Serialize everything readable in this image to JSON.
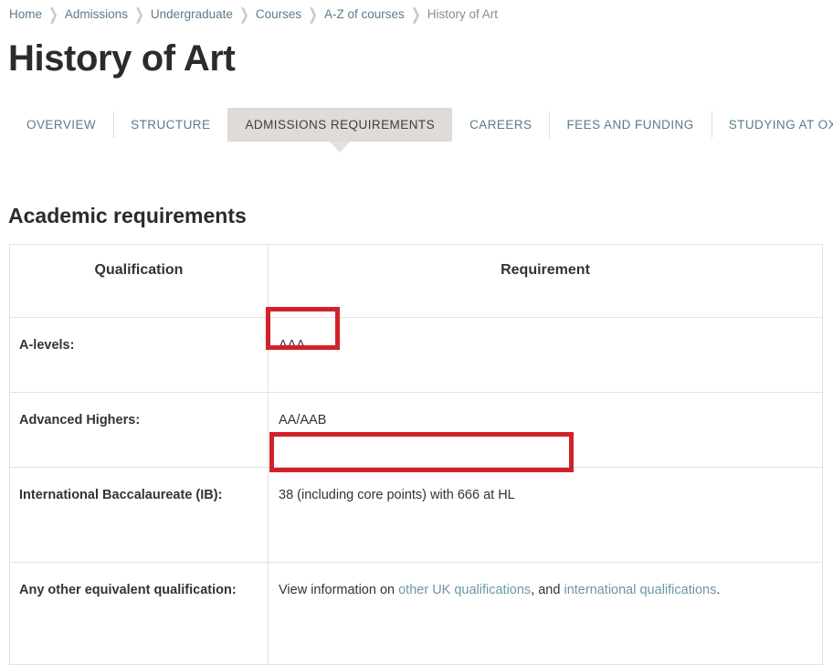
{
  "breadcrumb": {
    "separator": "❯",
    "items": [
      {
        "label": "Home",
        "current": false
      },
      {
        "label": "Admissions",
        "current": false
      },
      {
        "label": "Undergraduate",
        "current": false
      },
      {
        "label": "Courses",
        "current": false
      },
      {
        "label": "A-Z of courses",
        "current": false
      },
      {
        "label": "History of Art",
        "current": true
      }
    ]
  },
  "page": {
    "title": "History of Art",
    "section_heading": "Academic requirements"
  },
  "tabs": [
    {
      "label": "OVERVIEW",
      "active": false
    },
    {
      "label": "STRUCTURE",
      "active": false
    },
    {
      "label": "ADMISSIONS REQUIREMENTS",
      "active": true
    },
    {
      "label": "CAREERS",
      "active": false
    },
    {
      "label": "FEES AND FUNDING",
      "active": false
    },
    {
      "label": "STUDYING AT OXFORD",
      "active": false
    }
  ],
  "table": {
    "headers": {
      "qualification": "Qualification",
      "requirement": "Requirement"
    },
    "rows": [
      {
        "qualification": "A-levels:",
        "requirement": "AAA",
        "highlighted": true
      },
      {
        "qualification": "Advanced Highers:",
        "requirement": "AA/AAB",
        "highlighted": false
      },
      {
        "qualification": "International Baccalaureate (IB):",
        "requirement": "38 (including core points) with 666 at HL",
        "highlighted": true
      },
      {
        "qualification": "Any other equivalent qualification:",
        "requirement_prefix": "View information on ",
        "requirement_link1": "other UK qualifications",
        "requirement_middle": ", and ",
        "requirement_link2": "international qualifications",
        "requirement_suffix": ".",
        "highlighted": false
      }
    ]
  },
  "colors": {
    "annotation": "#d12229",
    "link": "#6b96a8",
    "active_tab_bg": "#dedbd8"
  }
}
